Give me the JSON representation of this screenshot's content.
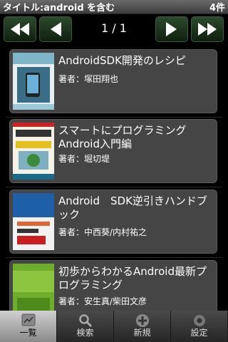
{
  "titlebar": {
    "query": "タイトル:android を含む",
    "count": "4件"
  },
  "pager": {
    "page": "1 / 1"
  },
  "books": [
    {
      "title": "AndroidSDK開発のレシピ",
      "author": "著者：塚田翔也"
    },
    {
      "title": "スマートにプログラミングAndroid入門編",
      "author": "著者：堀切堤"
    },
    {
      "title": "Android　SDK逆引きハンドブック",
      "author": "著者：中西葵/内村祐之"
    },
    {
      "title": "初歩からわかるAndroid最新プログラミング",
      "author": "著者：安生真/柴田文彦"
    }
  ],
  "tabs": [
    {
      "label": "一覧",
      "icon": "list-icon"
    },
    {
      "label": "検索",
      "icon": "search-icon"
    },
    {
      "label": "新規",
      "icon": "add-icon"
    },
    {
      "label": "設定",
      "icon": "settings-icon"
    }
  ],
  "colors": {
    "accent_green": "#2d4a2d",
    "card_bg": "#454545"
  }
}
